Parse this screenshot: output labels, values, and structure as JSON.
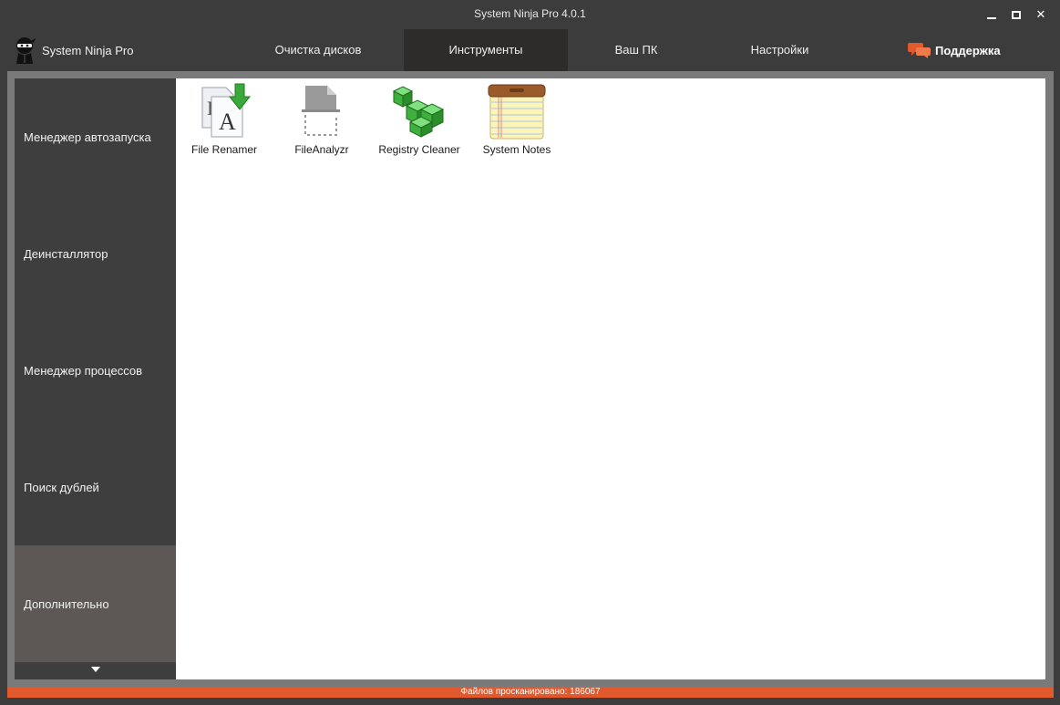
{
  "window": {
    "title": "System Ninja Pro 4.0.1"
  },
  "brand": {
    "name": "System Ninja Pro"
  },
  "tabs": [
    {
      "label": "Очистка дисков",
      "active": false
    },
    {
      "label": "Инструменты",
      "active": true
    },
    {
      "label": "Ваш ПК",
      "active": false
    },
    {
      "label": "Настройки",
      "active": false
    }
  ],
  "support": {
    "label": "Поддержка",
    "icon": "chat-bubbles-icon",
    "color": "#e1592c"
  },
  "sidebar": {
    "items": [
      {
        "label": "Менеджер автозапуска",
        "active": false
      },
      {
        "label": "Деинсталлятор",
        "active": false
      },
      {
        "label": "Менеджер процессов",
        "active": false
      },
      {
        "label": "Поиск дублей",
        "active": false
      },
      {
        "label": "Дополнительно",
        "active": true
      }
    ],
    "scroll_icon": "triangle-down-icon"
  },
  "tools": [
    {
      "label": "File Renamer",
      "icon": "file-renamer-icon"
    },
    {
      "label": "FileAnalyzr",
      "icon": "file-analyzr-icon"
    },
    {
      "label": "Registry Cleaner",
      "icon": "registry-cleaner-icon"
    },
    {
      "label": "System Notes",
      "icon": "system-notes-icon"
    }
  ],
  "status": {
    "text": "Файлов просканировано: 186067"
  },
  "colors": {
    "accent": "#e1592c",
    "chrome": "#3c3c3c",
    "active_tab": "#2e2b2b",
    "sidebar_active": "#5d5856"
  }
}
